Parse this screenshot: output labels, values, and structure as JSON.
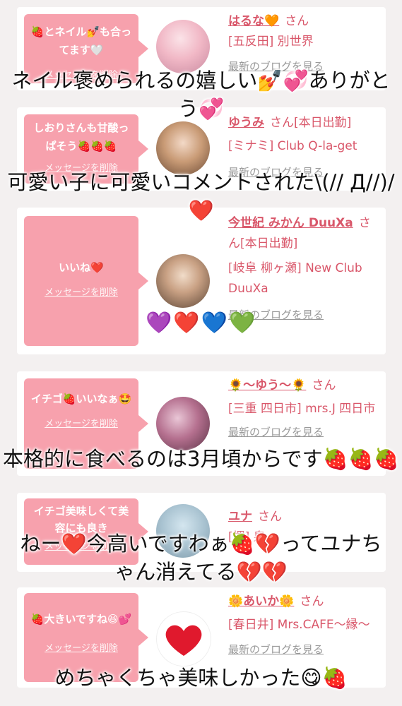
{
  "colors": {
    "accent": "#d9576a",
    "bubble": "#f7a1ad"
  },
  "cards": [
    {
      "message": "🍓とネイル💅も合ってます🤍",
      "delete_label": "メッセージを削除",
      "name": "はるな🧡",
      "honorific": "さん",
      "shop": "[五反田] 別世界",
      "blog": "最新のブログを見る"
    },
    {
      "message": "しおりさんも甘酸っぱそう🍓🍓🍓",
      "delete_label": "メッセージを削除",
      "name": "ゆうみ",
      "honorific": "さん[本日出勤]",
      "shop": "[ミナミ] Club Q-la-get",
      "blog": "最新のブログを見る"
    },
    {
      "message": "いいね❤️",
      "delete_label": "メッセージを削除",
      "name": "今世紀 みかん DuuXa",
      "honorific": "さん[本日出勤]",
      "shop": "[岐阜 柳ヶ瀬] New Club DuuXa",
      "blog": "最新のブログを見る"
    },
    {
      "message": "イチゴ🍓いいなぁ🤩",
      "delete_label": "メッセージを削除",
      "name": "🌻〜ゆう〜🌻",
      "honorific": "さん",
      "shop": "[三重 四日市] mrs.J 四日市",
      "blog": "最新のブログを見る"
    },
    {
      "message": "イチゴ美味しくて美容にも良き",
      "delete_label": "メッセージを削除",
      "name": "ユナ",
      "honorific": "さん",
      "shop": "[堺] 泉",
      "blog": ""
    },
    {
      "message": "🍓大きいですね😆💕",
      "delete_label": "メッセージを削除",
      "name": "🌼あいか🌼",
      "honorific": "さん",
      "shop": "[春日井] Mrs.CAFE〜縁〜",
      "blog": "最新のブログを見る"
    }
  ],
  "captions": [
    "ネイル褒められるの嬉しい💅💞ありがとう💞",
    "可愛い子に可愛いコメントされた\\(// Д//)/❤️",
    "本格的に食べるのは3月頃からです🍓🍓🍓",
    "ねー❤️今高いですわぁ🍓💔ってユナちゃん消えてる💔💔",
    "めちゃくちゃ美味しかった😋🍓"
  ],
  "hearts_row": "💜❤️💙💚"
}
